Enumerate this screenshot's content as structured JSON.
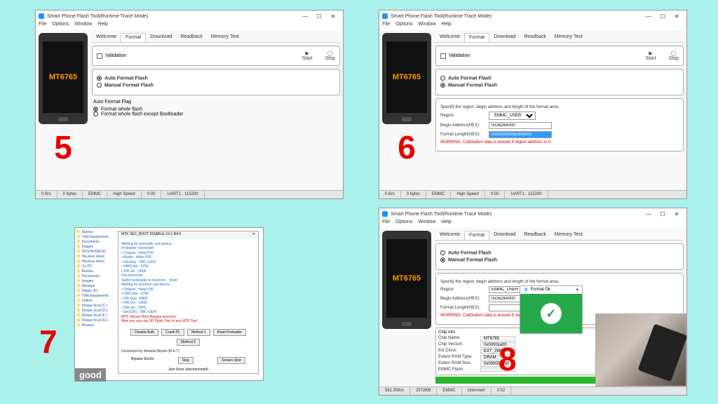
{
  "window_title": "Smart Phone Flash Tool(Runtime Trace Mode)",
  "menu": {
    "file": "File",
    "options": "Options",
    "window": "Window",
    "help": "Help"
  },
  "tabs": {
    "welcome": "Welcome",
    "format": "Format",
    "download": "Download",
    "readback": "Readback",
    "memtest": "Memory Test"
  },
  "validation": "Validation",
  "actions": {
    "start": "Start",
    "stop": "Stop"
  },
  "panel5": {
    "opt_auto": "Auto Format Flash",
    "opt_manual": "Manual Format Flash",
    "sub_title": "Auto Format Flag",
    "sub_whole": "Format whole flash",
    "sub_except": "Format whole flash except Bootloader"
  },
  "panel6": {
    "opt_auto": "Auto Format Flash",
    "opt_manual": "Manual Format Flash",
    "hint": "Specify the region, begin address and length of the format area.",
    "region_label": "Region",
    "region_value": "EMMC_USER",
    "begin_label": "Begin Address(HEX):",
    "begin_value": "0x1628A000",
    "len_label": "Format Length(HEX):",
    "len_value": "0x00000003E800000",
    "warn": "WARNING: Calibration data is erased if region address is 0."
  },
  "phone_chip": "MT6765",
  "status": {
    "a": "0 B/s",
    "b": "0 bytes",
    "c": "EMMC",
    "d": "High Speed",
    "e": "0:00",
    "f": "UART1 , 115200"
  },
  "panel7": {
    "dialog_title": "MTK SEC_BOOT DISABLE V4.1 R4.0",
    "lines": [
      "Waiting for preloader usb device...",
      "Preloader connected",
      "• Chipset : Helio P35",
      "• Model : Helio P35",
      "• Security : SBC+SDA",
      "• HWCode : 0766",
      "• SW Ver : 0000",
      "Disconnected",
      "Switch preloader to bootrom... done!",
      "Waiting for bootrom usb device...",
      "• Chipset : Helio P35",
      "• HWCode : 0766",
      "• HW Sub : 8A00",
      "• HW Ver : CA00",
      "• SW Ver : 0000",
      "• SecCFG : SBC+SDA",
      "MTK Secure Boot Bypass success!",
      "Now you can use SP Flash Tool or any MTK Tool"
    ],
    "buttons": {
      "disable": "Disable Auth",
      "crash": "Crash PL",
      "m1": "Method 1",
      "m2": "Read Preloader",
      "m3": "Method 3"
    },
    "dev": "Developed by Mofadal Altyeb (M.R.T)",
    "btn_stop": "Stop",
    "btn_server": "Screen Shot",
    "status": "Bypass Sector",
    "status2": "Just Done (disconnected)",
    "good": "good",
    "tree": [
      "Bureau",
      "Téléchargements",
      "Documents",
      "Images",
      "DPGH5XQF2I3",
      "Heureux dessi",
      "Heureux dessi",
      "Ce PC",
      "Bureau",
      "Documents",
      "Images",
      "Musique",
      "Objets 3D",
      "Téléchargements",
      "Vidéos",
      "Disque local (C:)",
      "Disque local (D:)",
      "Disque local (F:)",
      "Disque local (G:)",
      "Réseau"
    ]
  },
  "panel8": {
    "format_ok_title": "Format Ok",
    "chip_title": "Chip Info",
    "chip_name_l": "Chip Name:",
    "chip_name_v": "MT6765",
    "chip_ver_l": "Chip Version:",
    "chip_ver_v": "0x0000ca00",
    "ext_clock_l": "Ext Clock:",
    "ext_clock_v": "EXT_26M",
    "ram_type_l": "Extern RAM Type:",
    "ram_type_v": "DRAM",
    "ram_size_l": "Extern RAM Size:",
    "ram_size_v": "0x000000000",
    "emmc_l": "EMMC Flash:",
    "status": {
      "a": "581.25K/s",
      "b": "2572KB",
      "c": "EMMC",
      "d": "Unknown",
      "e": "0:02"
    }
  },
  "steps": {
    "s5": "5",
    "s6": "6",
    "s7": "7",
    "s8": "8"
  }
}
